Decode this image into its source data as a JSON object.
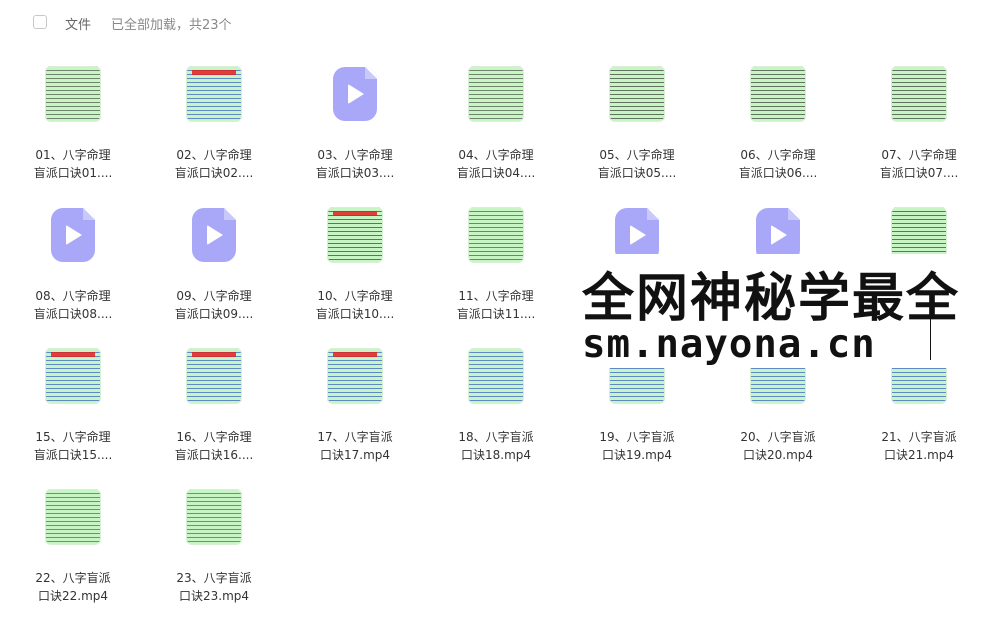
{
  "toolbar": {
    "column_label": "文件",
    "status": "已全部加载，共23个"
  },
  "files": [
    {
      "line1": "01、八字命理",
      "line2": "盲派口诀01....",
      "kind": "doc"
    },
    {
      "line1": "02、八字命理",
      "line2": "盲派口诀02....",
      "kind": "doc"
    },
    {
      "line1": "03、八字命理",
      "line2": "盲派口诀03....",
      "kind": "video"
    },
    {
      "line1": "04、八字命理",
      "line2": "盲派口诀04....",
      "kind": "doc"
    },
    {
      "line1": "05、八字命理",
      "line2": "盲派口诀05....",
      "kind": "doc"
    },
    {
      "line1": "06、八字命理",
      "line2": "盲派口诀06....",
      "kind": "doc"
    },
    {
      "line1": "07、八字命理",
      "line2": "盲派口诀07....",
      "kind": "doc"
    },
    {
      "line1": "08、八字命理",
      "line2": "盲派口诀08....",
      "kind": "video"
    },
    {
      "line1": "09、八字命理",
      "line2": "盲派口诀09....",
      "kind": "video"
    },
    {
      "line1": "10、八字命理",
      "line2": "盲派口诀10....",
      "kind": "doc"
    },
    {
      "line1": "11、八字命理",
      "line2": "盲派口诀11....",
      "kind": "doc"
    },
    {
      "line1": "",
      "line2": "",
      "kind": "video"
    },
    {
      "line1": "",
      "line2": "",
      "kind": "video"
    },
    {
      "line1": "",
      "line2": "",
      "kind": "doc"
    },
    {
      "line1": "15、八字命理",
      "line2": "盲派口诀15....",
      "kind": "doc"
    },
    {
      "line1": "16、八字命理",
      "line2": "盲派口诀16....",
      "kind": "doc"
    },
    {
      "line1": "17、八字盲派",
      "line2": "口诀17.mp4",
      "kind": "doc"
    },
    {
      "line1": "18、八字盲派",
      "line2": "口诀18.mp4",
      "kind": "doc"
    },
    {
      "line1": "19、八字盲派",
      "line2": "口诀19.mp4",
      "kind": "doc"
    },
    {
      "line1": "20、八字盲派",
      "line2": "口诀20.mp4",
      "kind": "doc"
    },
    {
      "line1": "21、八字盲派",
      "line2": "口诀21.mp4",
      "kind": "doc"
    },
    {
      "line1": "22、八字盲派",
      "line2": "口诀22.mp4",
      "kind": "doc"
    },
    {
      "line1": "23、八字盲派",
      "line2": "口诀23.mp4",
      "kind": "doc"
    }
  ],
  "overlay": {
    "line1": "全网神秘学最全",
    "line2": "sm.nayona.cn"
  }
}
